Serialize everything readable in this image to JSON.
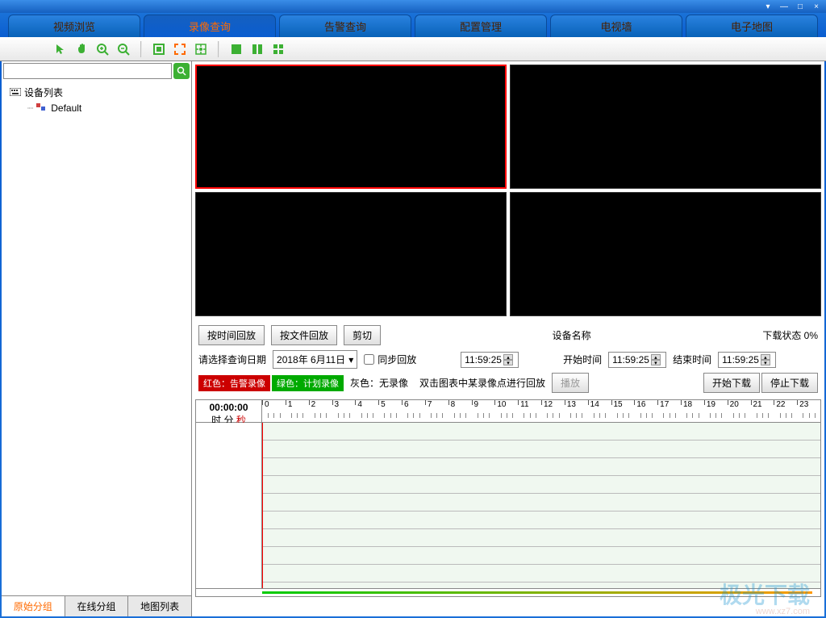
{
  "window": {
    "dropdown": "▾",
    "minimize": "—",
    "maximize": "□",
    "close": "×"
  },
  "tabs": {
    "video_browse": "视频浏览",
    "record_query": "录像查询",
    "alarm_query": "告警查询",
    "config_mgmt": "配置管理",
    "tv_wall": "电视墙",
    "emap": "电子地图"
  },
  "sidebar": {
    "search_placeholder": "",
    "device_list": "设备列表",
    "default_node": "Default",
    "tabs": {
      "original_group": "原始分组",
      "online_group": "在线分组",
      "map_list": "地图列表"
    }
  },
  "controls": {
    "playback_by_time": "按时间回放",
    "playback_by_file": "按文件回放",
    "cut": "剪切",
    "device_name": "设备名称",
    "download_status": "下载状态 0%",
    "select_date_label": "请选择查询日期",
    "date_value": "2018年 6月11日",
    "sync_playback": "同步回放",
    "time_display": "11:59:25",
    "start_time_label": "开始时间",
    "start_time": "11:59:25",
    "end_time_label": "结束时间",
    "end_time": "11:59:25",
    "start_download": "开始下载",
    "stop_download": "停止下载",
    "play": "播放",
    "legend_red": "红色：告警录像",
    "legend_green": "绿色：计划录像",
    "legend_gray": "灰色：无录像",
    "legend_hint": "双击图表中某录像点进行回放"
  },
  "timeline": {
    "clock": "00:00:00",
    "clock_hms": "时 分 ",
    "clock_sec": "秒",
    "hours": [
      "0",
      "1",
      "2",
      "3",
      "4",
      "5",
      "6",
      "7",
      "8",
      "9",
      "10",
      "11",
      "12",
      "13",
      "14",
      "15",
      "16",
      "17",
      "18",
      "19",
      "20",
      "21",
      "22",
      "23"
    ]
  },
  "watermark": {
    "text": "极光下载",
    "url": "www.xz7.com"
  }
}
